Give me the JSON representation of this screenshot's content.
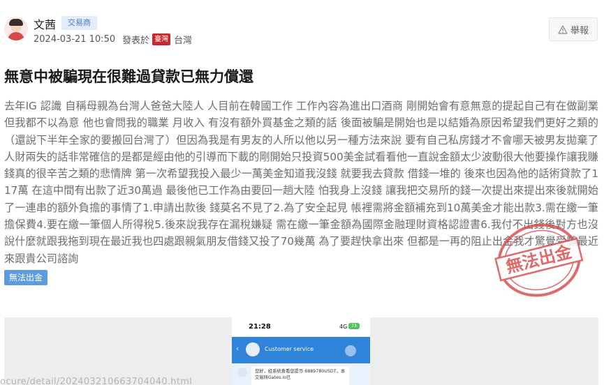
{
  "post": {
    "author": "文茜",
    "role_badge": "交易商",
    "datetime": "2024-03-21 10:50",
    "posted_at_label": "發表於",
    "region_flag": "臺灣",
    "region_name": "台灣",
    "report_label": "舉報",
    "title": "無意中被騙現在很難過貸款已無力償還",
    "body": "去年IG 認識 自稱母親為台灣人爸爸大陸人 人目前在韓國工作 工作內容為進出口酒商 剛開始會有意無意的提起自己有在做副業 但我都不以為意 他也會問我的職業 月收入 有沒有額外買基金之類的話 後面被騙是開始也是以結婚為原因希望我們更好之類的（還說下半年全家的要搬回台灣了）但因為我是有男友的人所以他以另一種方法來說 要有自己私房錢才不會哪天被男友拋棄了人財兩失的話非常確信的是都是經由他的引導而下載的剛開始只投資500美金試看看他一直說金額太少波動很大他要操作讓我賺錢真的很辛苦之類的悲情牌 第一次希望我投入最少一萬美金知道我沒錢 就要我去貸款 借錢一堆的 後來也因為他的話術貸款了117萬 在這中間有出款了近30萬過 最後他已工作為由要回一趟大陸 怕我身上沒錢 讓我把交易所的錢一次提出來提出來後就開始了一連串的額外負擔的事情了1.申請出款後 錢莫名不見了2.為了安全起見 帳裡需將金額補充到10萬美金才能出款3.需在繳一筆擔保費4.要在繳一筆個人所得稅5.後來說我存在漏稅嫌疑 需在繳一筆金額為國際金融理財資格認證書6.我付不出錢後對方也沒說什麼就跟我拖到現在最近我也四處跟親氣朋友借錢又投了70幾萬 為了要趕快拿出來 但都是一再的阻止出金我才驚覺受騙最近來跟貴公司諮詢",
    "tag": "無法出金",
    "stamp_text": "無法出金"
  },
  "screenshot_preview": {
    "time": "21:28",
    "network": "4G",
    "battery": "73",
    "chat_title": "Customer service",
    "message": "您好，经系统查看您提币 6889780USDT，本交易所Gates.io已"
  },
  "url_text": "ocure/detail/202403210663704040.html",
  "colors": {
    "accent": "#5b9bde",
    "flag_red": "#c8282d",
    "stamp_red": "#d84a4a"
  }
}
